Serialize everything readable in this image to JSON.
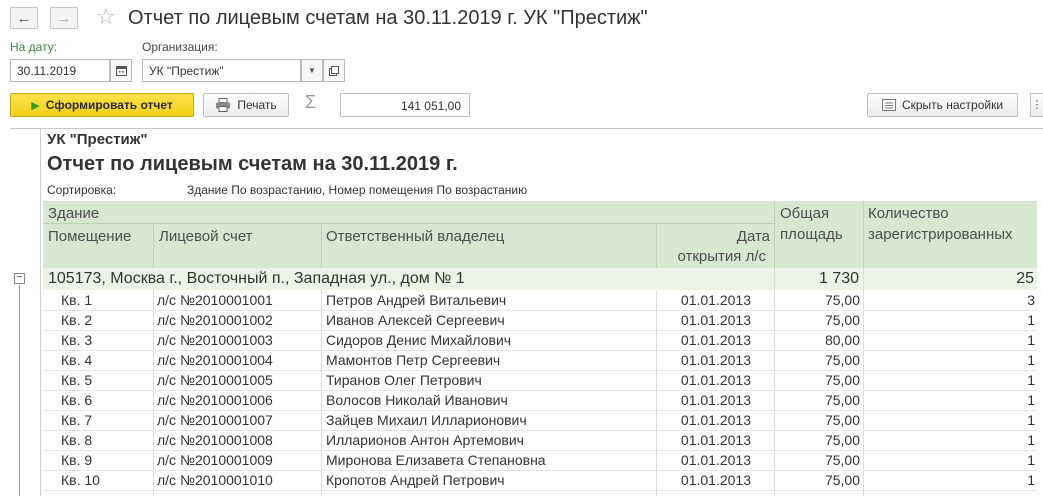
{
  "window": {
    "title": "Отчет по лицевым счетам на 30.11.2019 г. УК \"Престиж\"",
    "back_icon": "arrow-left",
    "forward_icon": "arrow-right",
    "favorite_icon": "star"
  },
  "params": {
    "date_label": "На дату:",
    "date_value": "30.11.2019",
    "org_label": "Организация:",
    "org_value": "УК \"Престиж\""
  },
  "toolbar": {
    "generate_label": "Сформировать отчет",
    "print_label": "Печать",
    "sum_value": "141 051,00",
    "hide_settings_label": "Скрыть настройки"
  },
  "report": {
    "org": "УК \"Престиж\"",
    "title": "Отчет по лицевым счетам на 30.11.2019 г.",
    "sort_label": "Сортировка:",
    "sort_value": "Здание По возрастанию, Номер помещения По возрастанию",
    "headers": {
      "building": "Здание",
      "room": "Помещение",
      "account": "Лицевой счет",
      "owner": "Ответственный владелец",
      "open_date_1": "Дата",
      "open_date_2": "открытия л/с",
      "area_1": "Общая",
      "area_2": "площадь",
      "count_1": "Количество",
      "count_2": "зарегистрированных"
    },
    "group": {
      "name": "105173, Москва г., Восточный п., Западная ул., дом № 1",
      "area": "1 730",
      "count": "25"
    },
    "rows": [
      {
        "room": "Кв. 1",
        "account": "л/с №2010001001",
        "owner": "Петров Андрей Витальевич",
        "date": "01.01.2013",
        "area": "75,00",
        "count": "3"
      },
      {
        "room": "Кв. 2",
        "account": "л/с №2010001002",
        "owner": "Иванов Алексей Сергеевич",
        "date": "01.01.2013",
        "area": "75,00",
        "count": "1"
      },
      {
        "room": "Кв. 3",
        "account": "л/с №2010001003",
        "owner": "Сидоров Денис Михайлович",
        "date": "01.01.2013",
        "area": "80,00",
        "count": "1"
      },
      {
        "room": "Кв. 4",
        "account": "л/с №2010001004",
        "owner": "Мамонтов Петр Сергеевич",
        "date": "01.01.2013",
        "area": "75,00",
        "count": "1"
      },
      {
        "room": "Кв. 5",
        "account": "л/с №2010001005",
        "owner": "Тиранов Олег Петрович",
        "date": "01.01.2013",
        "area": "75,00",
        "count": "1"
      },
      {
        "room": "Кв. 6",
        "account": "л/с №2010001006",
        "owner": "Волосов Николай Иванович",
        "date": "01.01.2013",
        "area": "75,00",
        "count": "1"
      },
      {
        "room": "Кв. 7",
        "account": "л/с №2010001007",
        "owner": "Зайцев Михаил Илларионович",
        "date": "01.01.2013",
        "area": "75,00",
        "count": "1"
      },
      {
        "room": "Кв. 8",
        "account": "л/с №2010001008",
        "owner": "Илларионов Антон Артемович",
        "date": "01.01.2013",
        "area": "75,00",
        "count": "1"
      },
      {
        "room": "Кв. 9",
        "account": "л/с №2010001009",
        "owner": "Миронова Елизавета Степановна",
        "date": "01.01.2013",
        "area": "75,00",
        "count": "1"
      },
      {
        "room": "Кв. 10",
        "account": "л/с №2010001010",
        "owner": "Кропотов Андрей Петрович",
        "date": "01.01.2013",
        "area": "75,00",
        "count": "1"
      }
    ]
  }
}
